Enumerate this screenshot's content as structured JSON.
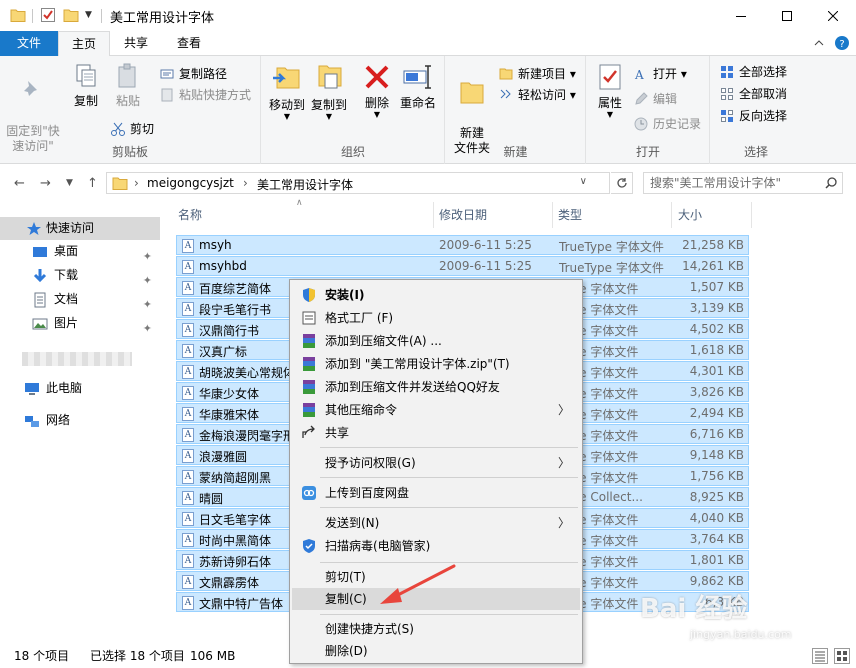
{
  "window": {
    "title": "美工常用设计字体"
  },
  "tabs": {
    "file": "文件",
    "home": "主页",
    "share": "共享",
    "view": "查看"
  },
  "ribbon": {
    "clipboard": {
      "label": "剪贴板",
      "pin": "固定到\"快\n速访问\"",
      "copy": "复制",
      "paste": "粘贴",
      "copy_path": "复制路径",
      "paste_shortcut": "粘贴快捷方式",
      "cut": "剪切"
    },
    "organize": {
      "label": "组织",
      "move_to": "移动到",
      "copy_to": "复制到",
      "delete": "删除",
      "rename": "重命名"
    },
    "new": {
      "label": "新建",
      "new_folder": "新建\n文件夹",
      "new_item": "新建项目",
      "easy_access": "轻松访问"
    },
    "open": {
      "label": "打开",
      "properties": "属性",
      "open": "打开",
      "edit": "编辑",
      "history": "历史记录"
    },
    "select": {
      "label": "选择",
      "select_all": "全部选择",
      "select_none": "全部取消",
      "invert": "反向选择"
    }
  },
  "address": {
    "crumbs": [
      "meigongcysjzt",
      "美工常用设计字体"
    ],
    "search_placeholder": "搜索\"美工常用设计字体\""
  },
  "nav": {
    "quick_access": "快速访问",
    "items": [
      {
        "label": "桌面"
      },
      {
        "label": "下载"
      },
      {
        "label": "文档"
      },
      {
        "label": "图片"
      }
    ],
    "this_pc": "此电脑",
    "network": "网络"
  },
  "columns": {
    "name": "名称",
    "date": "修改日期",
    "type": "类型",
    "size": "大小"
  },
  "files": [
    {
      "name": "msyh",
      "date": "2009-6-11 5:25",
      "type": "TrueType 字体文件",
      "size": "21,258 KB"
    },
    {
      "name": "msyhbd",
      "date": "2009-6-11 5:25",
      "type": "TrueType 字体文件",
      "size": "14,261 KB"
    },
    {
      "name": "百度综艺简体",
      "date": "",
      "type": "Type 字体文件",
      "size": "1,507 KB"
    },
    {
      "name": "段宁毛笔行书",
      "date": "",
      "type": "Type 字体文件",
      "size": "3,139 KB"
    },
    {
      "name": "汉鼎简行书",
      "date": "",
      "type": "Type 字体文件",
      "size": "4,502 KB"
    },
    {
      "name": "汉真广标",
      "date": "",
      "type": "Type 字体文件",
      "size": "1,618 KB"
    },
    {
      "name": "胡晓波美心常规体",
      "date": "",
      "type": "Type 字体文件",
      "size": "4,301 KB"
    },
    {
      "name": "华康少女体",
      "date": "",
      "type": "Type 字体文件",
      "size": "3,826 KB"
    },
    {
      "name": "华康雅宋体",
      "date": "",
      "type": "Type 字体文件",
      "size": "2,494 KB"
    },
    {
      "name": "金梅浪漫閃毫字形",
      "date": "",
      "type": "Type 字体文件",
      "size": "6,716 KB"
    },
    {
      "name": "浪漫雅圆",
      "date": "",
      "type": "Type 字体文件",
      "size": "9,148 KB"
    },
    {
      "name": "蒙纳简超刚黑",
      "date": "",
      "type": "Type 字体文件",
      "size": "1,756 KB"
    },
    {
      "name": "晴圆",
      "date": "",
      "type": "Type Collect...",
      "size": "8,925 KB"
    },
    {
      "name": "日文毛笔字体",
      "date": "",
      "type": "Type 字体文件",
      "size": "4,040 KB"
    },
    {
      "name": "时尚中黑简体",
      "date": "",
      "type": "Type 字体文件",
      "size": "3,764 KB"
    },
    {
      "name": "苏新诗卵石体",
      "date": "",
      "type": "Type 字体文件",
      "size": "1,801 KB"
    },
    {
      "name": "文鼎霹雳体",
      "date": "",
      "type": "Type 字体文件",
      "size": "9,862 KB"
    },
    {
      "name": "文鼎中特广告体",
      "date": "",
      "type": "Type 字体文件",
      "size": "6,3 KB"
    }
  ],
  "context_menu": {
    "install": "安装(I)",
    "format_factory": "格式工厂 (F)",
    "add_archive": "添加到压缩文件(A) ...",
    "add_zip": "添加到 \"美工常用设计字体.zip\"(T)",
    "add_qq": "添加到压缩文件并发送给QQ好友",
    "other_compress": "其他压缩命令",
    "share": "共享",
    "give_access": "授予访问权限(G)",
    "baidu_upload": "上传到百度网盘",
    "send_to": "发送到(N)",
    "virus_scan": "扫描病毒(电脑管家)",
    "cut": "剪切(T)",
    "copy": "复制(C)",
    "create_shortcut": "创建快捷方式(S)",
    "delete": "删除(D)"
  },
  "status": {
    "count": "18 个项目",
    "selected": "已选择 18 个项目",
    "size": "106 MB"
  },
  "watermark": {
    "brand": "Bai 经验",
    "url": "jingyan.baidu.com"
  },
  "colors": {
    "accent": "#1979ca",
    "selection": "#cce8ff",
    "selection_border": "#99d1ff",
    "arrow": "#e8453c"
  }
}
